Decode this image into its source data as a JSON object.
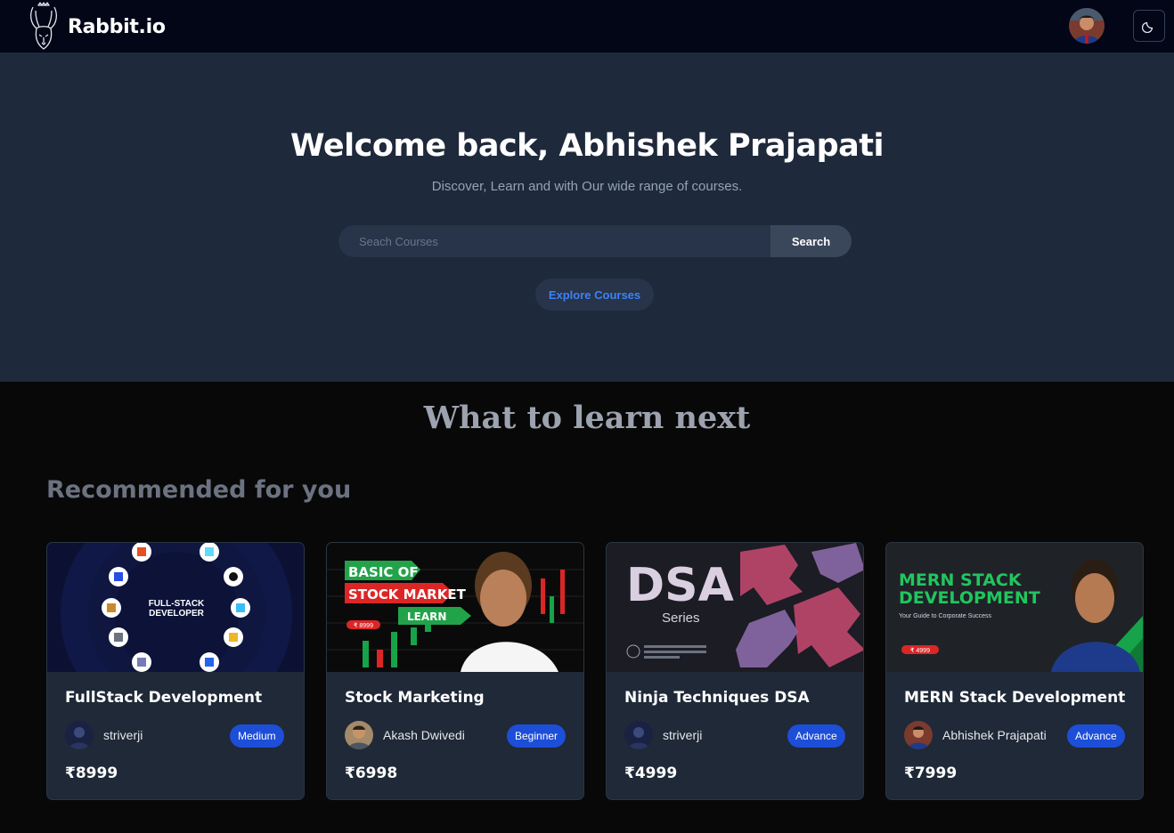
{
  "navbar": {
    "brand": "Rabbit.io",
    "avatar_icon": "user-avatar-icon",
    "theme_toggle_icon": "moon-icon"
  },
  "hero": {
    "title": "Welcome back, Abhishek Prajapati",
    "subtitle": "Discover, Learn and with Our wide range of courses.",
    "search_placeholder": "Seach Courses",
    "search_button": "Search",
    "explore_button": "Explore Courses"
  },
  "sections": {
    "learn_next": "What to learn next",
    "recommended": "Recommended for you"
  },
  "courses": [
    {
      "title": "FullStack Development",
      "author": "striverji",
      "level": "Medium",
      "price": "₹8999",
      "thumb": {
        "label": "FULL-STACK DEVELOPER"
      }
    },
    {
      "title": "Stock Marketing",
      "author": "Akash Dwivedi",
      "level": "Beginner",
      "price": "₹6998",
      "thumb": {
        "line1": "BASIC OF",
        "line2": "STOCK MARKET",
        "line3": "LEARN",
        "price_tag": "₹ 8999"
      }
    },
    {
      "title": "Ninja Techniques DSA",
      "author": "striverji",
      "level": "Advance",
      "price": "₹4999",
      "thumb": {
        "big": "DSA",
        "sub": "Series"
      }
    },
    {
      "title": "MERN Stack Development",
      "author": "Abhishek Prajapati",
      "level": "Advance",
      "price": "₹7999",
      "thumb": {
        "line1": "MERN STACK",
        "line2": "DEVELOPMENT",
        "tagline": "Your Guide to Corporate Success",
        "price_tag": "₹ 4999"
      }
    }
  ],
  "colors": {
    "nav_bg": "#020617",
    "hero_bg": "#1e293b",
    "content_bg": "#080808",
    "card_bg": "#1f2937",
    "accent": "#3b82f6",
    "badge_bg": "#1d4ed8"
  }
}
